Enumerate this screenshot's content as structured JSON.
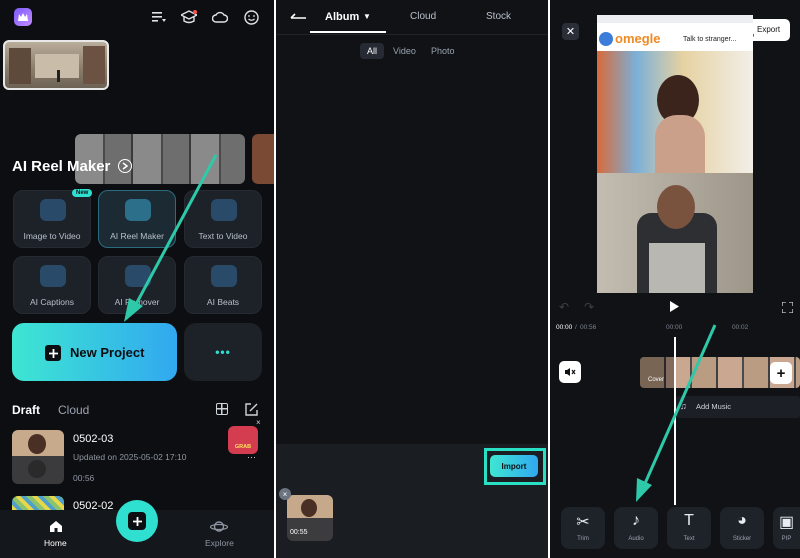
{
  "colors": {
    "accent": "#2fe0d0",
    "grad_start": "#3ee6d2",
    "grad_end": "#31a8f0",
    "highlight": "#29e0c4",
    "arrow": "#2dc9a8"
  },
  "panel1": {
    "reel_title": "AI Reel Maker",
    "tools": [
      {
        "label": "Image to Video",
        "icon": "image-to-video-icon",
        "badge": "New"
      },
      {
        "label": "AI Reel Maker",
        "icon": "reel-maker-icon"
      },
      {
        "label": "Text to Video",
        "icon": "text-to-video-icon"
      },
      {
        "label": "AI Captions",
        "icon": "captions-icon"
      },
      {
        "label": "AI Remover",
        "icon": "remover-icon"
      },
      {
        "label": "AI Beats",
        "icon": "beats-icon"
      }
    ],
    "new_project": "New Project",
    "more": "•••",
    "tabs": {
      "draft": "Draft",
      "cloud": "Cloud"
    },
    "projects": [
      {
        "name": "0502-03",
        "updated": "Updated on 2025-05-02 17:10",
        "duration": "00:56"
      },
      {
        "name": "0502-02"
      }
    ],
    "promo_badge": "GRAB",
    "nav": {
      "home": "Home",
      "explore": "Explore"
    }
  },
  "panel2": {
    "tabs": {
      "album": "Album",
      "cloud": "Cloud",
      "stock": "Stock"
    },
    "filters": {
      "all": "All",
      "video": "Video",
      "photo": "Photo"
    },
    "import": "Import",
    "selected_duration": "00:55"
  },
  "panel3": {
    "export": "Export",
    "video_overlay": {
      "site": "omegle",
      "tagline": "Talk to stranger..."
    },
    "time_current": "00:00",
    "time_total": "00:56",
    "ruler": [
      "00:00",
      "00:02"
    ],
    "cover": "Cover",
    "add_music": "Add Music",
    "tools": [
      {
        "label": "Trim",
        "glyph": "✂"
      },
      {
        "label": "Audio",
        "glyph": "♪"
      },
      {
        "label": "Text",
        "glyph": "T"
      },
      {
        "label": "Sticker",
        "glyph": "◕"
      },
      {
        "label": "PIP",
        "glyph": "▣"
      }
    ]
  }
}
